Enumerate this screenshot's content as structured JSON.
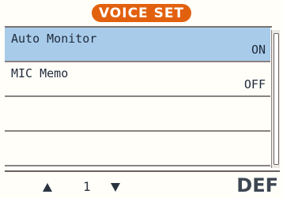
{
  "header": {
    "title": "VOICE SET"
  },
  "colors": {
    "title_pill": "#e2610f",
    "selected_row": "#a8cbea"
  },
  "rows": [
    {
      "label": "Auto Monitor",
      "value": "ON",
      "selected": true
    },
    {
      "label": "MIC Memo",
      "value": "OFF",
      "selected": false
    },
    {
      "label": "",
      "value": "",
      "selected": false
    },
    {
      "label": "",
      "value": "",
      "selected": false
    }
  ],
  "footer": {
    "page_number": "1",
    "def_label": "DEF",
    "up_icon": "triangle-up-icon",
    "down_icon": "triangle-down-icon"
  }
}
